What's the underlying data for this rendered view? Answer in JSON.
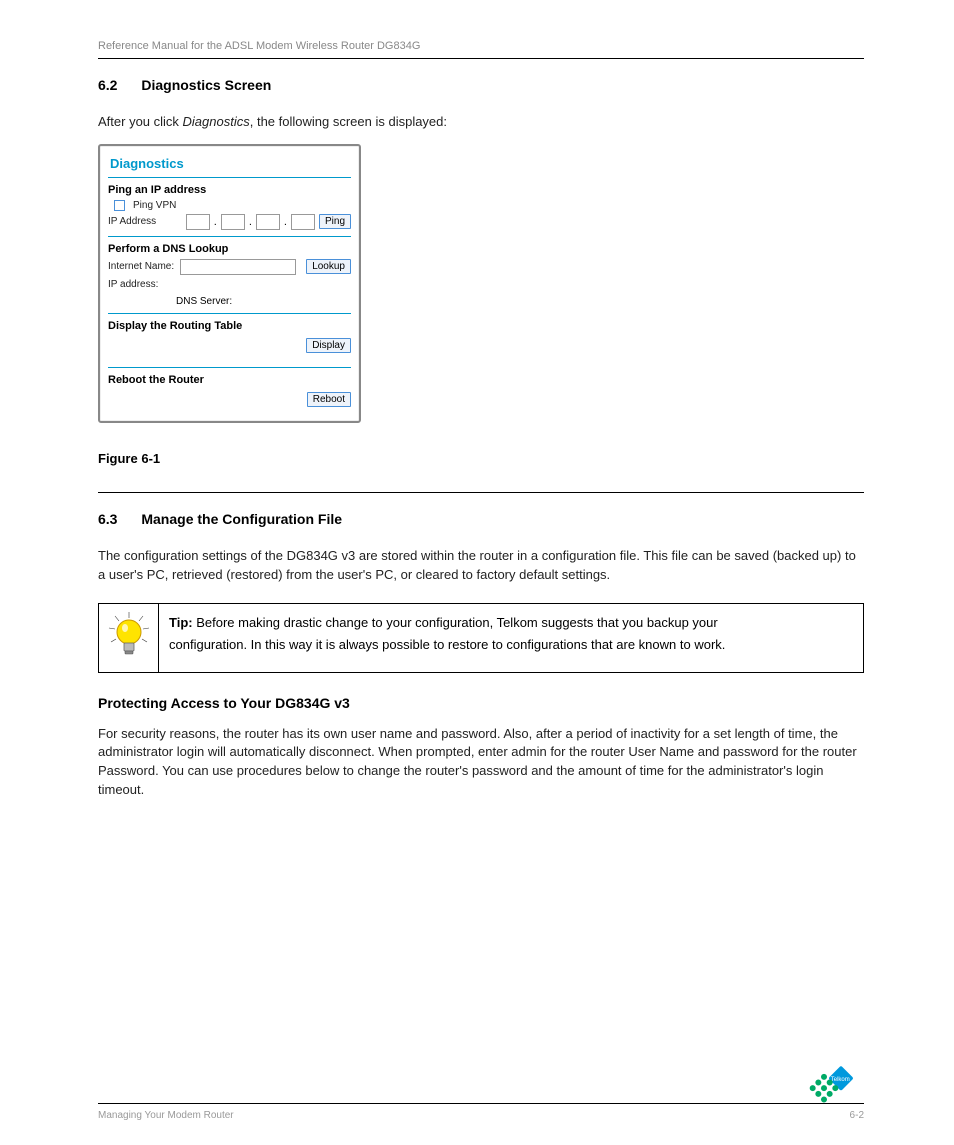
{
  "header": {
    "left": "Reference Manual for the ADSL Modem Wireless Router DG834G",
    "right": ""
  },
  "section_header": {
    "num": "6.2",
    "title": "Diagnostics Screen"
  },
  "intro_text_part1": "After you click ",
  "intro_text_em": "Diagnostics",
  "intro_text_part2": ", the following screen is displayed:",
  "diag": {
    "title": "Diagnostics",
    "ping_section": "Ping an IP address",
    "ping_vpn": "Ping VPN",
    "ip_address_label": "IP Address",
    "ping_btn": "Ping",
    "dns_section": "Perform a DNS Lookup",
    "internet_name_label": "Internet Name:",
    "lookup_btn": "Lookup",
    "ip_addr_row": "IP address:",
    "dns_server_row": "DNS Server:",
    "routing_section": "Display the Routing Table",
    "display_btn": "Display",
    "reboot_section": "Reboot the Router",
    "reboot_btn": "Reboot"
  },
  "figure_caption": "Figure 6-1",
  "section2": {
    "num": "6.3",
    "title": "Manage the Configuration File"
  },
  "section2_text": "The configuration settings of the DG834G v3 are stored within the router in a configuration file. This file can be saved (backed up) to a user's PC, retrieved (restored) from the user's PC, or cleared to factory default settings.",
  "tip": {
    "line1_a": "Tip: ",
    "line1_b": "Before making drastic change to your configuration, Telkom suggests that you backup your ",
    "line2": "configuration. In this way it is always possible to restore to configurations that are known to work."
  },
  "protecting_heading": "Protecting Access to Your DG834G v3",
  "protecting_text": "For security reasons, the router has its own user name and password. Also, after a period of inactivity for a set length of time, the administrator login will automatically disconnect. When prompted, enter admin for the router User Name and password for the router Password. You can use procedures below to change the router's password and the amount of time for the administrator's login timeout.",
  "footer": {
    "left": "Managing Your Modem Router",
    "right": "6-2"
  },
  "logo_text": "Telkom"
}
